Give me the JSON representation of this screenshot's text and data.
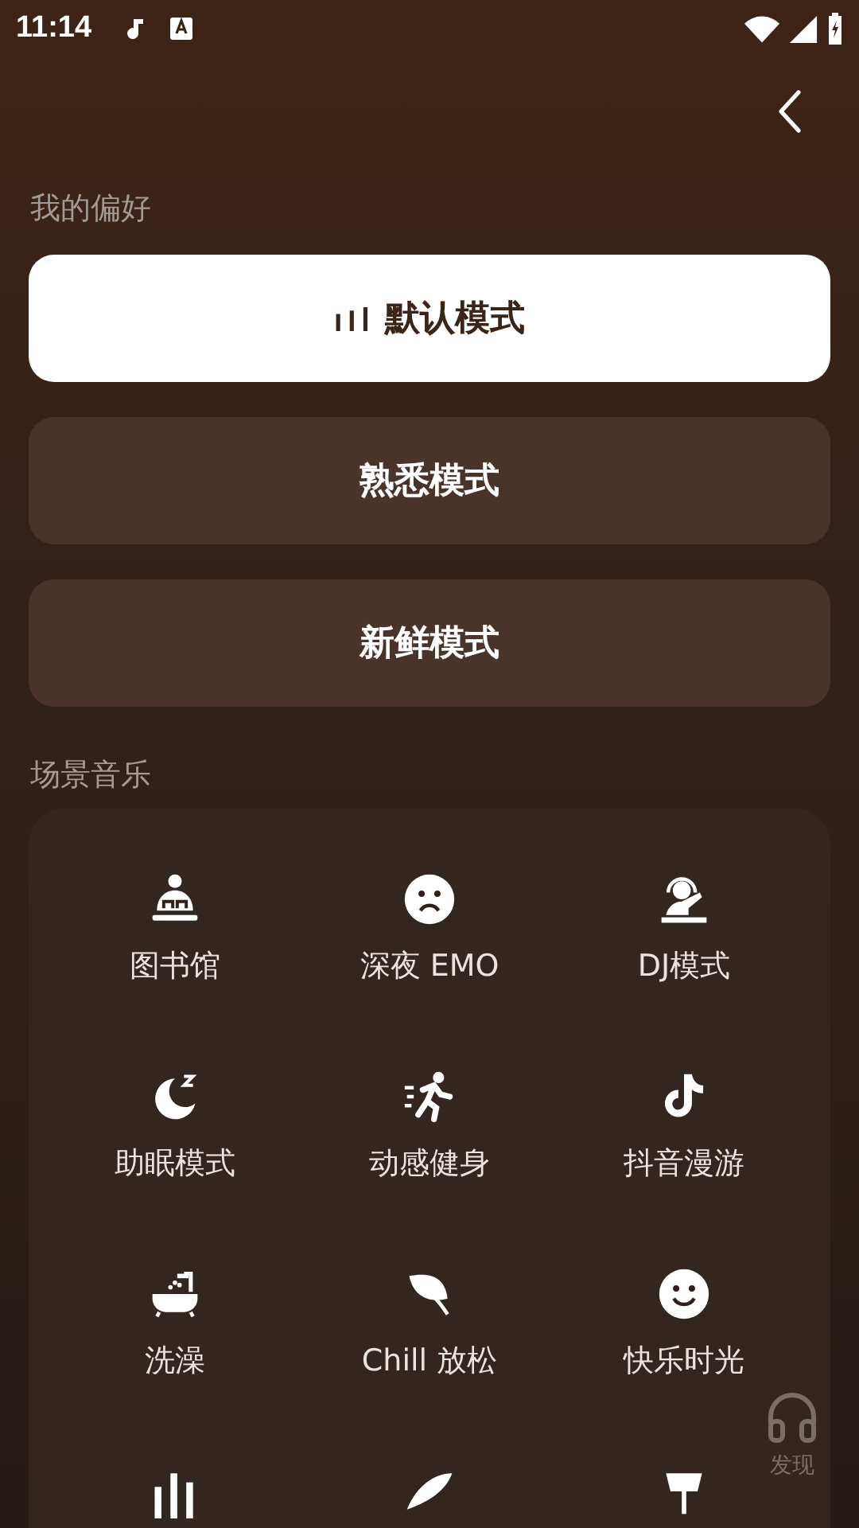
{
  "status_bar": {
    "time": "11:14"
  },
  "preferences": {
    "title": "我的偏好",
    "modes": [
      {
        "label": "默认模式",
        "selected": true
      },
      {
        "label": "熟悉模式",
        "selected": false
      },
      {
        "label": "新鲜模式",
        "selected": false
      }
    ]
  },
  "scenes": {
    "title": "场景音乐",
    "items": [
      {
        "label": "图书馆"
      },
      {
        "label": "深夜 EMO"
      },
      {
        "label": "DJ模式"
      },
      {
        "label": "助眠模式"
      },
      {
        "label": "动感健身"
      },
      {
        "label": "抖音漫游"
      },
      {
        "label": "洗澡"
      },
      {
        "label": "Chill 放松"
      },
      {
        "label": "快乐时光"
      }
    ]
  },
  "floating_button": {
    "label": "发现"
  }
}
